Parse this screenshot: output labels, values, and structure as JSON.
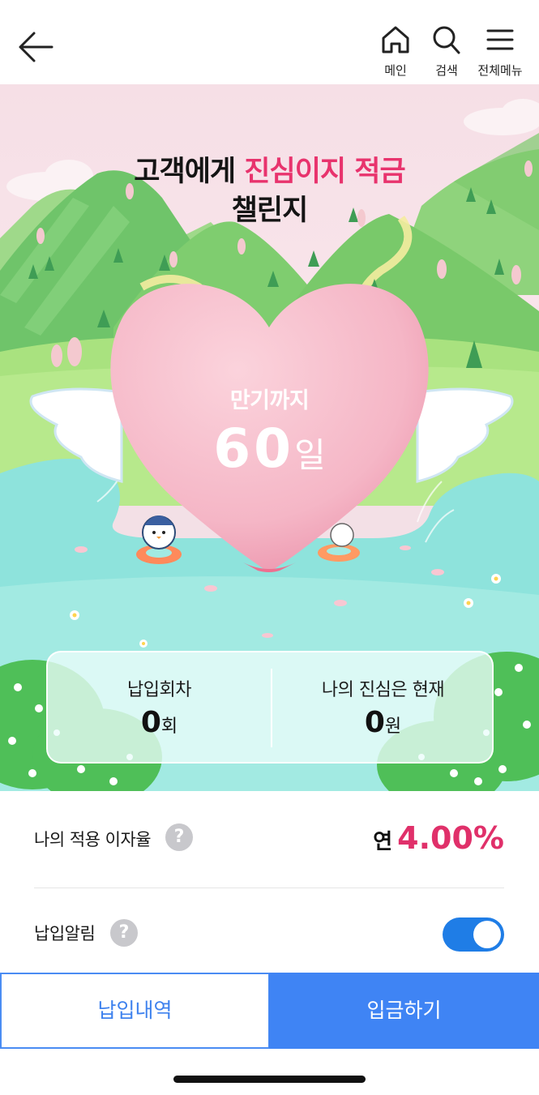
{
  "header": {
    "main_label": "메인",
    "search_label": "검색",
    "menu_label": "전체메뉴"
  },
  "hero": {
    "title_part1": "고객에게 ",
    "title_highlight": "진심이지 적금",
    "title_line2": "챌린지",
    "heart_caption": "만기까지",
    "days_value": "60",
    "days_unit": "일"
  },
  "summary": {
    "payments_label": "납입회차",
    "payments_value": "0",
    "payments_unit": "회",
    "current_label": "나의 진심은 현재",
    "current_value": "0",
    "current_unit": "원"
  },
  "rate": {
    "label": "나의 적용 이자율",
    "prefix": "연",
    "value": "4.00%"
  },
  "alert": {
    "label": "납입알림",
    "enabled": true
  },
  "help_glyph": "?",
  "buttons": {
    "history": "납입내역",
    "deposit": "입금하기"
  },
  "colors": {
    "accent_pink": "#e8336d",
    "primary_blue": "#3f84f4",
    "toggle_blue": "#1f7de6"
  }
}
